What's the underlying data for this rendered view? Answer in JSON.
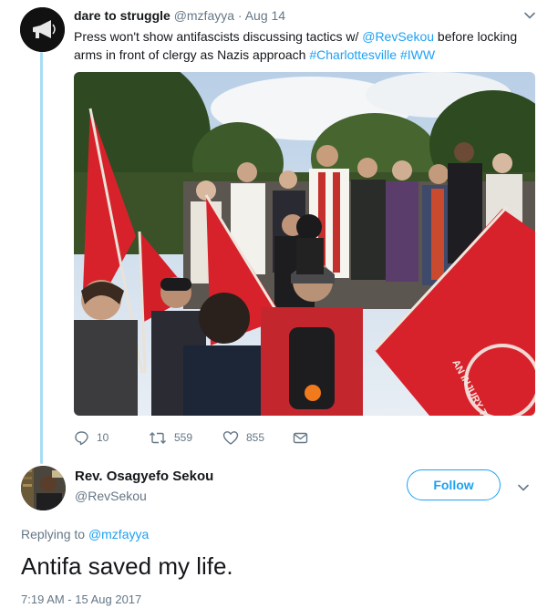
{
  "parent_tweet": {
    "name": "dare to struggle",
    "handle": "@mzfayya",
    "separator": "·",
    "date": "Aug 14",
    "text_part1": "Press won't show antifascists discussing tactics w/ ",
    "mention": "@RevSekou",
    "text_part2": " before locking arms in front of clergy as Nazis approach ",
    "hashtag1": "#Charlottesville",
    "hashtag2": "#IWW",
    "photo_banner_text": "AN INJURY TO",
    "actions": {
      "reply_count": "10",
      "retweet_count": "559",
      "like_count": "855"
    }
  },
  "reply_tweet": {
    "name": "Rev. Osagyefo Sekou",
    "handle": "@RevSekou",
    "follow_label": "Follow",
    "replying_prefix": "Replying to ",
    "replying_to": "@mzfayya",
    "text": "Antifa saved my life.",
    "timestamp": "7:19 AM - 15 Aug 2017"
  },
  "colors": {
    "accent": "#1da1f2",
    "thread_line": "#a6ddf5",
    "muted": "#657786",
    "text": "#14171a",
    "flag_red": "#d8222b"
  },
  "icons": {
    "reply": "reply-icon",
    "retweet": "retweet-icon",
    "like": "heart-icon",
    "dm": "envelope-icon",
    "caret": "chevron-down-icon"
  }
}
